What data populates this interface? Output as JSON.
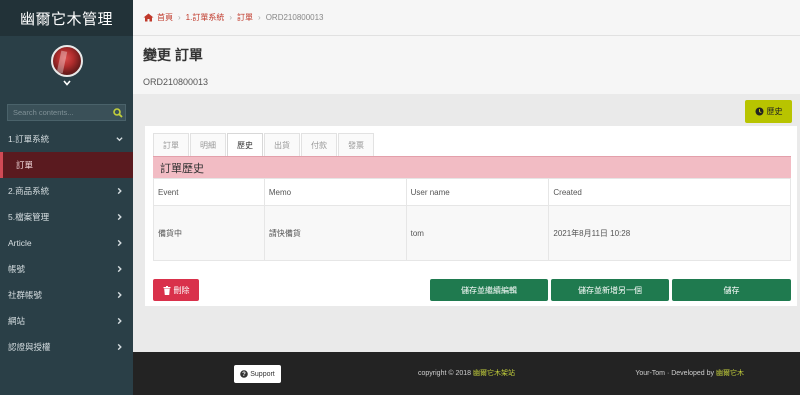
{
  "sidebar": {
    "brand": "幽爾它木管理",
    "search_placeholder": "Search contents...",
    "items": [
      {
        "label": "1.訂單系統"
      },
      {
        "label": "訂單"
      },
      {
        "label": "2.商品系統"
      },
      {
        "label": "5.檔案管理"
      },
      {
        "label": "Article"
      },
      {
        "label": "帳號"
      },
      {
        "label": "社群帳號"
      },
      {
        "label": "網站"
      },
      {
        "label": "認證與授權"
      }
    ]
  },
  "breadcrumb": {
    "home": "首頁",
    "items": [
      "1.訂單系統",
      "訂單",
      "ORD210800013"
    ]
  },
  "page": {
    "title": "變更 訂單",
    "subtitle": "ORD210800013",
    "history_button": "歷史"
  },
  "tabs": [
    "訂單",
    "明細",
    "歷史",
    "出貨",
    "付款",
    "發票"
  ],
  "section_title": "訂單歷史",
  "table": {
    "headers": [
      "Event",
      "Memo",
      "User name",
      "Created"
    ],
    "rows": [
      [
        "備貨中",
        "請快備貨",
        "tom",
        "2021年8月11日 10:28"
      ]
    ]
  },
  "actions": {
    "delete": "刪除",
    "save_continue": "儲存並繼續編輯",
    "save_add": "儲存並新增另一個",
    "save": "儲存"
  },
  "footer": {
    "support": "Support",
    "copyright": "copyright © 2018",
    "copyright_link": "幽爾它木架站",
    "developed_by": "Your-Tom · Developed by",
    "developer_link": "幽爾它木"
  },
  "colors": {
    "sidebar": "#2a3f47",
    "active_menu": "#5a1a1f",
    "section_head": "#f2bcc4",
    "danger": "#d9314b",
    "success": "#1f7a4f",
    "accent_olive": "#b8c400"
  }
}
